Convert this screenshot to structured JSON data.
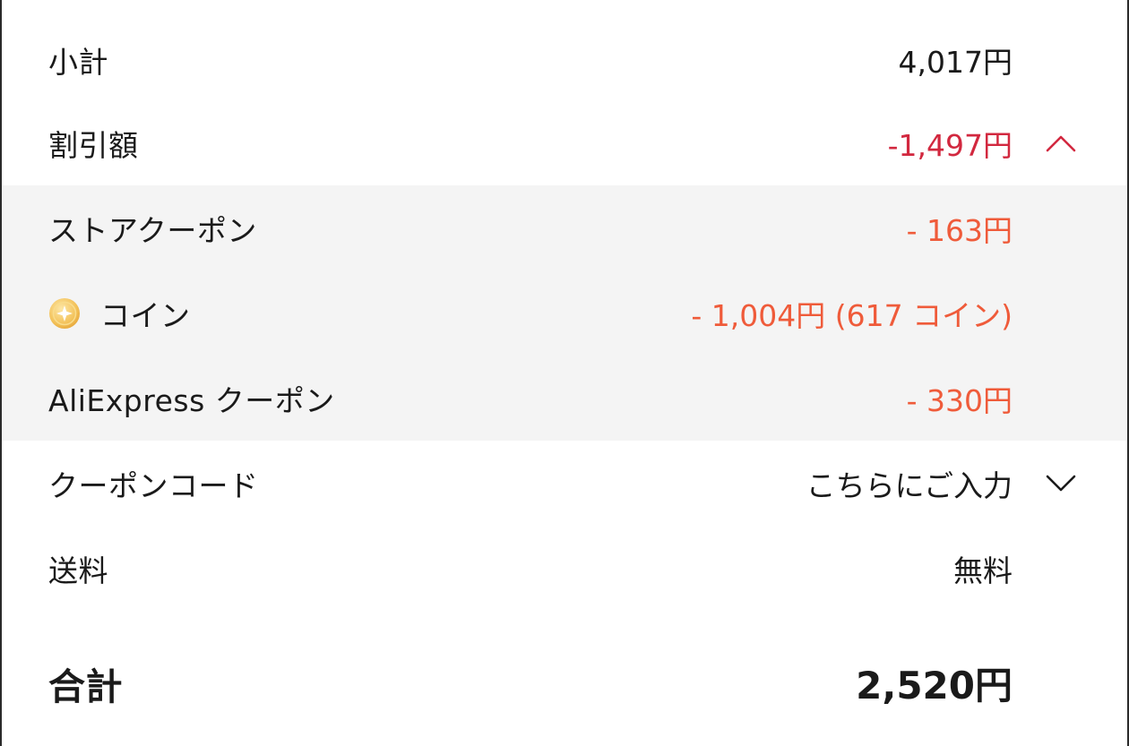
{
  "summary": {
    "subtotal": {
      "label": "小計",
      "value": "4,017円"
    },
    "discount": {
      "label": "割引額",
      "value": "-1,497円",
      "expanded": true
    },
    "discount_items": [
      {
        "label": "ストアクーポン",
        "value": "- 163円"
      },
      {
        "label": "コイン",
        "value": "- 1,004円 (617 コイン)",
        "icon": "coin-icon"
      },
      {
        "label": "AliExpress クーポン",
        "value": "- 330円"
      }
    ],
    "coupon_code": {
      "label": "クーポンコード",
      "placeholder": "こちらにご入力"
    },
    "shipping": {
      "label": "送料",
      "value": "無料"
    },
    "total": {
      "label": "合計",
      "value": "2,520円"
    }
  },
  "colors": {
    "discount_red": "#d2283f",
    "subitem_orange": "#ef5b3a",
    "subsection_bg": "#f4f4f4"
  }
}
